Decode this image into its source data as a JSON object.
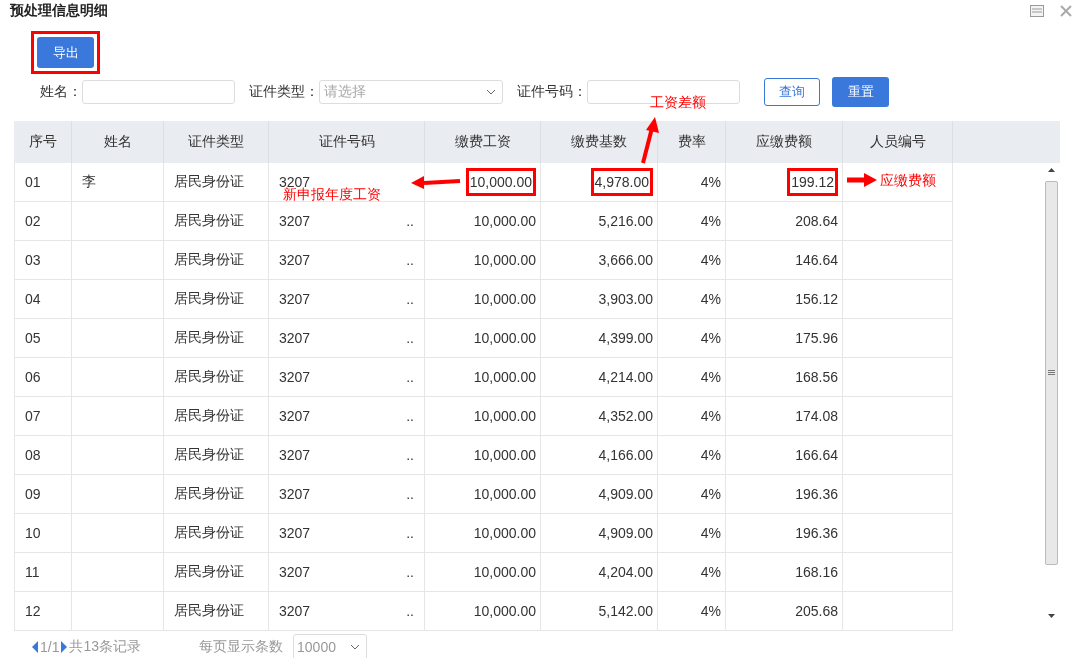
{
  "window": {
    "title": "预处理信息明细"
  },
  "toolbar": {
    "export_button": {
      "label": "导出",
      "boxed": true
    }
  },
  "filters": {
    "name_label": "姓名：",
    "id_type_label": "证件类型：",
    "id_type_placeholder": "请选择",
    "id_number_label": "证件号码：",
    "query_button": "查询",
    "reset_button": "重置"
  },
  "table": {
    "columns": [
      "序号",
      "姓名",
      "证件类型",
      "证件号码",
      "缴费工资",
      "缴费基数",
      "费率",
      "应缴费额",
      "人员编号"
    ],
    "rows": [
      {
        "seq": "01",
        "name": "李",
        "id_type": "居民身份证",
        "id_number": "3207",
        "salary": "10,000.00",
        "base": "4,978.00",
        "rate": "4%",
        "due": "199.12",
        "boxed": {
          "salary": true,
          "base": true,
          "due": true
        }
      },
      {
        "seq": "02",
        "id_type": "居民身份证",
        "id_number": "3207",
        "id_tail": "..",
        "salary": "10,000.00",
        "base": "5,216.00",
        "rate": "4%",
        "due": "208.64"
      },
      {
        "seq": "03",
        "id_type": "居民身份证",
        "id_number": "3207",
        "id_tail": "..",
        "salary": "10,000.00",
        "base": "3,666.00",
        "rate": "4%",
        "due": "146.64"
      },
      {
        "seq": "04",
        "id_type": "居民身份证",
        "id_number": "3207",
        "id_tail": "..",
        "salary": "10,000.00",
        "base": "3,903.00",
        "rate": "4%",
        "due": "156.12"
      },
      {
        "seq": "05",
        "id_type": "居民身份证",
        "id_number": "3207",
        "id_tail": "..",
        "salary": "10,000.00",
        "base": "4,399.00",
        "rate": "4%",
        "due": "175.96"
      },
      {
        "seq": "06",
        "id_type": "居民身份证",
        "id_number": "3207",
        "id_tail": "..",
        "salary": "10,000.00",
        "base": "4,214.00",
        "rate": "4%",
        "due": "168.56"
      },
      {
        "seq": "07",
        "id_type": "居民身份证",
        "id_number": "3207",
        "id_tail": "..",
        "salary": "10,000.00",
        "base": "4,352.00",
        "rate": "4%",
        "due": "174.08"
      },
      {
        "seq": "08",
        "id_type": "居民身份证",
        "id_number": "3207",
        "id_tail": "..",
        "salary": "10,000.00",
        "base": "4,166.00",
        "rate": "4%",
        "due": "166.64"
      },
      {
        "seq": "09",
        "id_type": "居民身份证",
        "id_number": "3207",
        "id_tail": "..",
        "salary": "10,000.00",
        "base": "4,909.00",
        "rate": "4%",
        "due": "196.36"
      },
      {
        "seq": "10",
        "id_type": "居民身份证",
        "id_number": "3207",
        "id_tail": "..",
        "salary": "10,000.00",
        "base": "4,909.00",
        "rate": "4%",
        "due": "196.36"
      },
      {
        "seq": "11",
        "id_type": "居民身份证",
        "id_number": "3207",
        "id_tail": "..",
        "salary": "10,000.00",
        "base": "4,204.00",
        "rate": "4%",
        "due": "168.16"
      },
      {
        "seq": "12",
        "id_type": "居民身份证",
        "id_number": "3207",
        "id_tail": "..",
        "salary": "10,000.00",
        "base": "5,142.00",
        "rate": "4%",
        "due": "205.68"
      }
    ]
  },
  "annotations": [
    {
      "text": "新申报年度工资",
      "kind": "left"
    },
    {
      "text": "工资差额",
      "kind": "up"
    },
    {
      "text": "应缴费额",
      "kind": "right"
    }
  ],
  "pagination": {
    "page": "1/1",
    "total": "共13条记录",
    "page_size_label": "每页显示条数",
    "page_size": "10000"
  }
}
